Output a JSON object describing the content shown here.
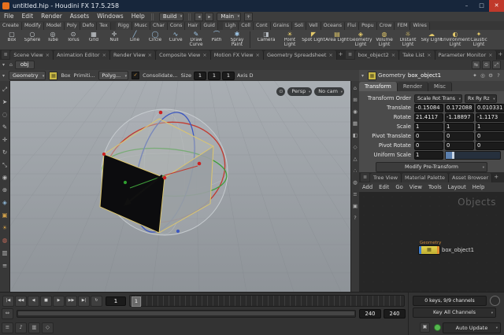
{
  "window": {
    "title": "untitled.hip - Houdini FX 17.5.258",
    "minimize": "–",
    "maximize": "□",
    "close": "✕"
  },
  "menubar": {
    "items": [
      "File",
      "Edit",
      "Render",
      "Assets",
      "Windows",
      "Help"
    ],
    "desktop": "Build",
    "scene": "Main"
  },
  "shelf": {
    "tabs_a": [
      "Create",
      "Modify",
      "Model",
      "Poly",
      "Defo",
      "Tex"
    ],
    "tabs_b": [
      "Rigg",
      "Musc",
      "Char",
      "Cons",
      "Hair",
      "Guid"
    ],
    "tabs_c": [
      "Ligh",
      "Coll",
      "Cont",
      "Grains",
      "Soli",
      "Vell",
      "Oceans",
      "Flui",
      "Popu",
      "Crow",
      "FEM",
      "Wires"
    ],
    "tools_geo": [
      {
        "n": "box-tool",
        "g": "▢",
        "label": "Box",
        "c": "#cfd4d8"
      },
      {
        "n": "sphere-tool",
        "g": "○",
        "label": "Sphere",
        "c": "#cfd4d8"
      },
      {
        "n": "tube-tool",
        "g": "◎",
        "label": "Tube",
        "c": "#cfd4d8"
      },
      {
        "n": "torus-tool",
        "g": "⊙",
        "label": "Torus",
        "c": "#cfd4d8"
      },
      {
        "n": "grid-tool",
        "g": "▦",
        "label": "Grid",
        "c": "#cfd4d8"
      },
      {
        "n": "null-tool",
        "g": "✛",
        "label": "Null",
        "c": "#cfd4d8"
      },
      {
        "n": "line-tool",
        "g": "╱",
        "label": "Line",
        "c": "#9fc7e8"
      },
      {
        "n": "circle-tool",
        "g": "◯",
        "label": "Circle",
        "c": "#9fc7e8"
      },
      {
        "n": "curve-tool",
        "g": "∿",
        "label": "Curve",
        "c": "#9fc7e8"
      },
      {
        "n": "draw-curve-tool",
        "g": "✎",
        "label": "Draw Curve",
        "c": "#9fc7e8"
      },
      {
        "n": "path-tool",
        "g": "⌒",
        "label": "Path",
        "c": "#9fc7e8"
      },
      {
        "n": "spray-paint-tool",
        "g": "✱",
        "label": "Spray Paint",
        "c": "#9fc7e8"
      }
    ],
    "tools_light": [
      {
        "n": "camera-tool",
        "g": "◨",
        "label": "Camera",
        "c": "#b8bec4"
      },
      {
        "n": "point-light-tool",
        "g": "☀",
        "label": "Point Light",
        "c": "#e3c96a"
      },
      {
        "n": "spot-light-tool",
        "g": "◤",
        "label": "Spot Light",
        "c": "#e3c96a"
      },
      {
        "n": "area-light-tool",
        "g": "▤",
        "label": "Area Light",
        "c": "#e3c96a"
      },
      {
        "n": "geometry-light-tool",
        "g": "◈",
        "label": "Geometry Light",
        "c": "#e3c96a"
      },
      {
        "n": "volume-light-tool",
        "g": "◍",
        "label": "Volume Light",
        "c": "#e3c96a"
      },
      {
        "n": "distant-light-tool",
        "g": "☼",
        "label": "Distant Light",
        "c": "#e3c96a"
      },
      {
        "n": "sky-light-tool",
        "g": "☁",
        "label": "Sky Light",
        "c": "#e3c96a"
      },
      {
        "n": "environment-light-tool",
        "g": "◐",
        "label": "Environment Light",
        "c": "#e3c96a"
      },
      {
        "n": "caustic-light-tool",
        "g": "✦",
        "label": "Caustic Light",
        "c": "#e3c96a"
      }
    ]
  },
  "panes_left": [
    {
      "label": "Scene View"
    },
    {
      "label": "Animation Editor"
    },
    {
      "label": "Render View"
    },
    {
      "label": "Composite View"
    },
    {
      "label": "Motion FX View"
    },
    {
      "label": "Geometry Spreadsheet"
    }
  ],
  "panes_right": [
    {
      "label": "box_object2"
    },
    {
      "label": "Take List"
    },
    {
      "label": "Parameter Monitor"
    }
  ],
  "glyphs": {
    "add_tab": "+",
    "pane_menu": "≣",
    "home": "⌂",
    "caret_down": "▾",
    "lock": "⊙"
  },
  "path": {
    "context": "obj"
  },
  "optoolbar": {
    "state": "Geometry",
    "tool": "Box",
    "prim_label": "Primiti...",
    "prim_type": "Polyg...",
    "consolidate": "Consolidate...",
    "size_label": "Size",
    "size": [
      "1",
      "1",
      "1"
    ],
    "axis_label": "Axis D"
  },
  "viewport": {
    "persp_badge": "Persp",
    "cam_badge": "No cam"
  },
  "left_icons": [
    {
      "n": "expand-viewport-icon",
      "g": "⤢",
      "c": "#b9b9b9"
    },
    {
      "n": "select-icon",
      "g": "➤",
      "c": "#b9b9b9"
    },
    {
      "n": "lasso-select-icon",
      "g": "◌",
      "c": "#b9b9b9"
    },
    {
      "n": "paint-select-icon",
      "g": "✎",
      "c": "#b9b9b9"
    },
    {
      "n": "translate-icon",
      "g": "✛",
      "c": "#b9b9b9"
    },
    {
      "n": "rotate-icon",
      "g": "↻",
      "c": "#b9b9b9"
    },
    {
      "n": "scale-icon",
      "g": "⤡",
      "c": "#b9b9b9"
    },
    {
      "n": "pose-icon",
      "g": "◉",
      "c": "#b9b9b9"
    },
    {
      "n": "handles-icon",
      "g": "⊕",
      "c": "#b9b9b9"
    },
    {
      "n": "snap-icon",
      "g": "◈",
      "c": "#8fb8d8"
    },
    {
      "n": "view-camera-icon",
      "g": "▣",
      "c": "#d0a04a"
    },
    {
      "n": "light-icon",
      "g": "☀",
      "c": "#d0a04a"
    },
    {
      "n": "render-region-icon",
      "g": "◍",
      "c": "#c46a5a"
    },
    {
      "n": "flipbook-icon",
      "g": "▥",
      "c": "#b9b9b9"
    },
    {
      "n": "notes-icon",
      "g": "≡",
      "c": "#b9b9b9"
    }
  ],
  "right_icons": [
    {
      "n": "home-view-icon",
      "g": "⌂"
    },
    {
      "n": "frame-view-icon",
      "g": "⊞"
    },
    {
      "n": "persp-view-icon",
      "g": "◉"
    },
    {
      "n": "grid-toggle-icon",
      "g": "▦"
    },
    {
      "n": "shade-mode-icon",
      "g": "◧"
    },
    {
      "n": "wireframe-icon",
      "g": "◇"
    },
    {
      "n": "normals-icon",
      "g": "△"
    },
    {
      "n": "points-icon",
      "g": "∴"
    },
    {
      "n": "volume-icon",
      "g": "◍"
    },
    {
      "n": "display-options-icon",
      "g": "≡"
    },
    {
      "n": "snapshot-icon",
      "g": "▣"
    },
    {
      "n": "help-icon",
      "g": "?"
    }
  ],
  "params": {
    "header": {
      "node_type": "Geometry",
      "node_name": "box_object1"
    },
    "tabs": [
      "Transform",
      "Render",
      "Misc"
    ],
    "transform_order_label": "Transform Order",
    "transform_order": "Scale Rot Trans",
    "rotate_order": "Rx Ry Rz",
    "triples": [
      {
        "label": "Translate",
        "v": [
          "-0.15084",
          "0.172088",
          "0.010331"
        ]
      },
      {
        "label": "Rotate",
        "v": [
          "21.4117",
          "-1.18897",
          "-1.1173"
        ]
      },
      {
        "label": "Scale",
        "v": [
          "1",
          "1",
          "1"
        ]
      },
      {
        "label": "Pivot Translate",
        "v": [
          "0",
          "0",
          "0"
        ]
      },
      {
        "label": "Pivot Rotate",
        "v": [
          "0",
          "0",
          "0"
        ]
      }
    ],
    "uniform_scale_label": "Uniform Scale",
    "uniform_scale": "1",
    "pretransform_button": "Modify Pre-Transform"
  },
  "mid_tabs": [
    {
      "label": "Tree View"
    },
    {
      "label": "Material Palette"
    },
    {
      "label": "Asset Browser"
    }
  ],
  "network": {
    "menus": [
      "Add",
      "Edit",
      "Go",
      "View",
      "Tools",
      "Layout",
      "Help"
    ],
    "context_label": "Objects",
    "node_type": "Geometry",
    "node_name": "box_object1"
  },
  "playbar": {
    "transport": [
      {
        "n": "go-start-button",
        "g": "|◀"
      },
      {
        "n": "prev-key-button",
        "g": "◀◀"
      },
      {
        "n": "play-reverse-button",
        "g": "◀"
      },
      {
        "n": "stop-button",
        "g": "■"
      },
      {
        "n": "play-button",
        "g": "▶"
      },
      {
        "n": "next-key-button",
        "g": "▶▶"
      },
      {
        "n": "go-end-button",
        "g": "▶|"
      },
      {
        "n": "loop-button",
        "g": "↻"
      }
    ],
    "current_frame": "1",
    "playhead_label": "1",
    "range_fields": [
      "240",
      "240"
    ],
    "bottom_icons": [
      {
        "n": "playbar-menu-icon",
        "g": "≡"
      },
      {
        "n": "audio-icon",
        "g": "♪"
      },
      {
        "n": "performance-icon",
        "g": "▥"
      },
      {
        "n": "playbar-options-icon",
        "g": "◇"
      }
    ],
    "keys_info": "0 keys, 9/9 channels",
    "key_all": "Key All Channels",
    "auto_update": "Auto Update"
  },
  "colors": {
    "titlebar": "#17263b",
    "ring_x": "#c23a2f",
    "ring_y": "#3f9e3a",
    "ring_z": "#3c57c0",
    "node_yellow": "#d8c84a",
    "cook_state_green": "#54b84e",
    "cube_edge": "#dcc66e"
  }
}
